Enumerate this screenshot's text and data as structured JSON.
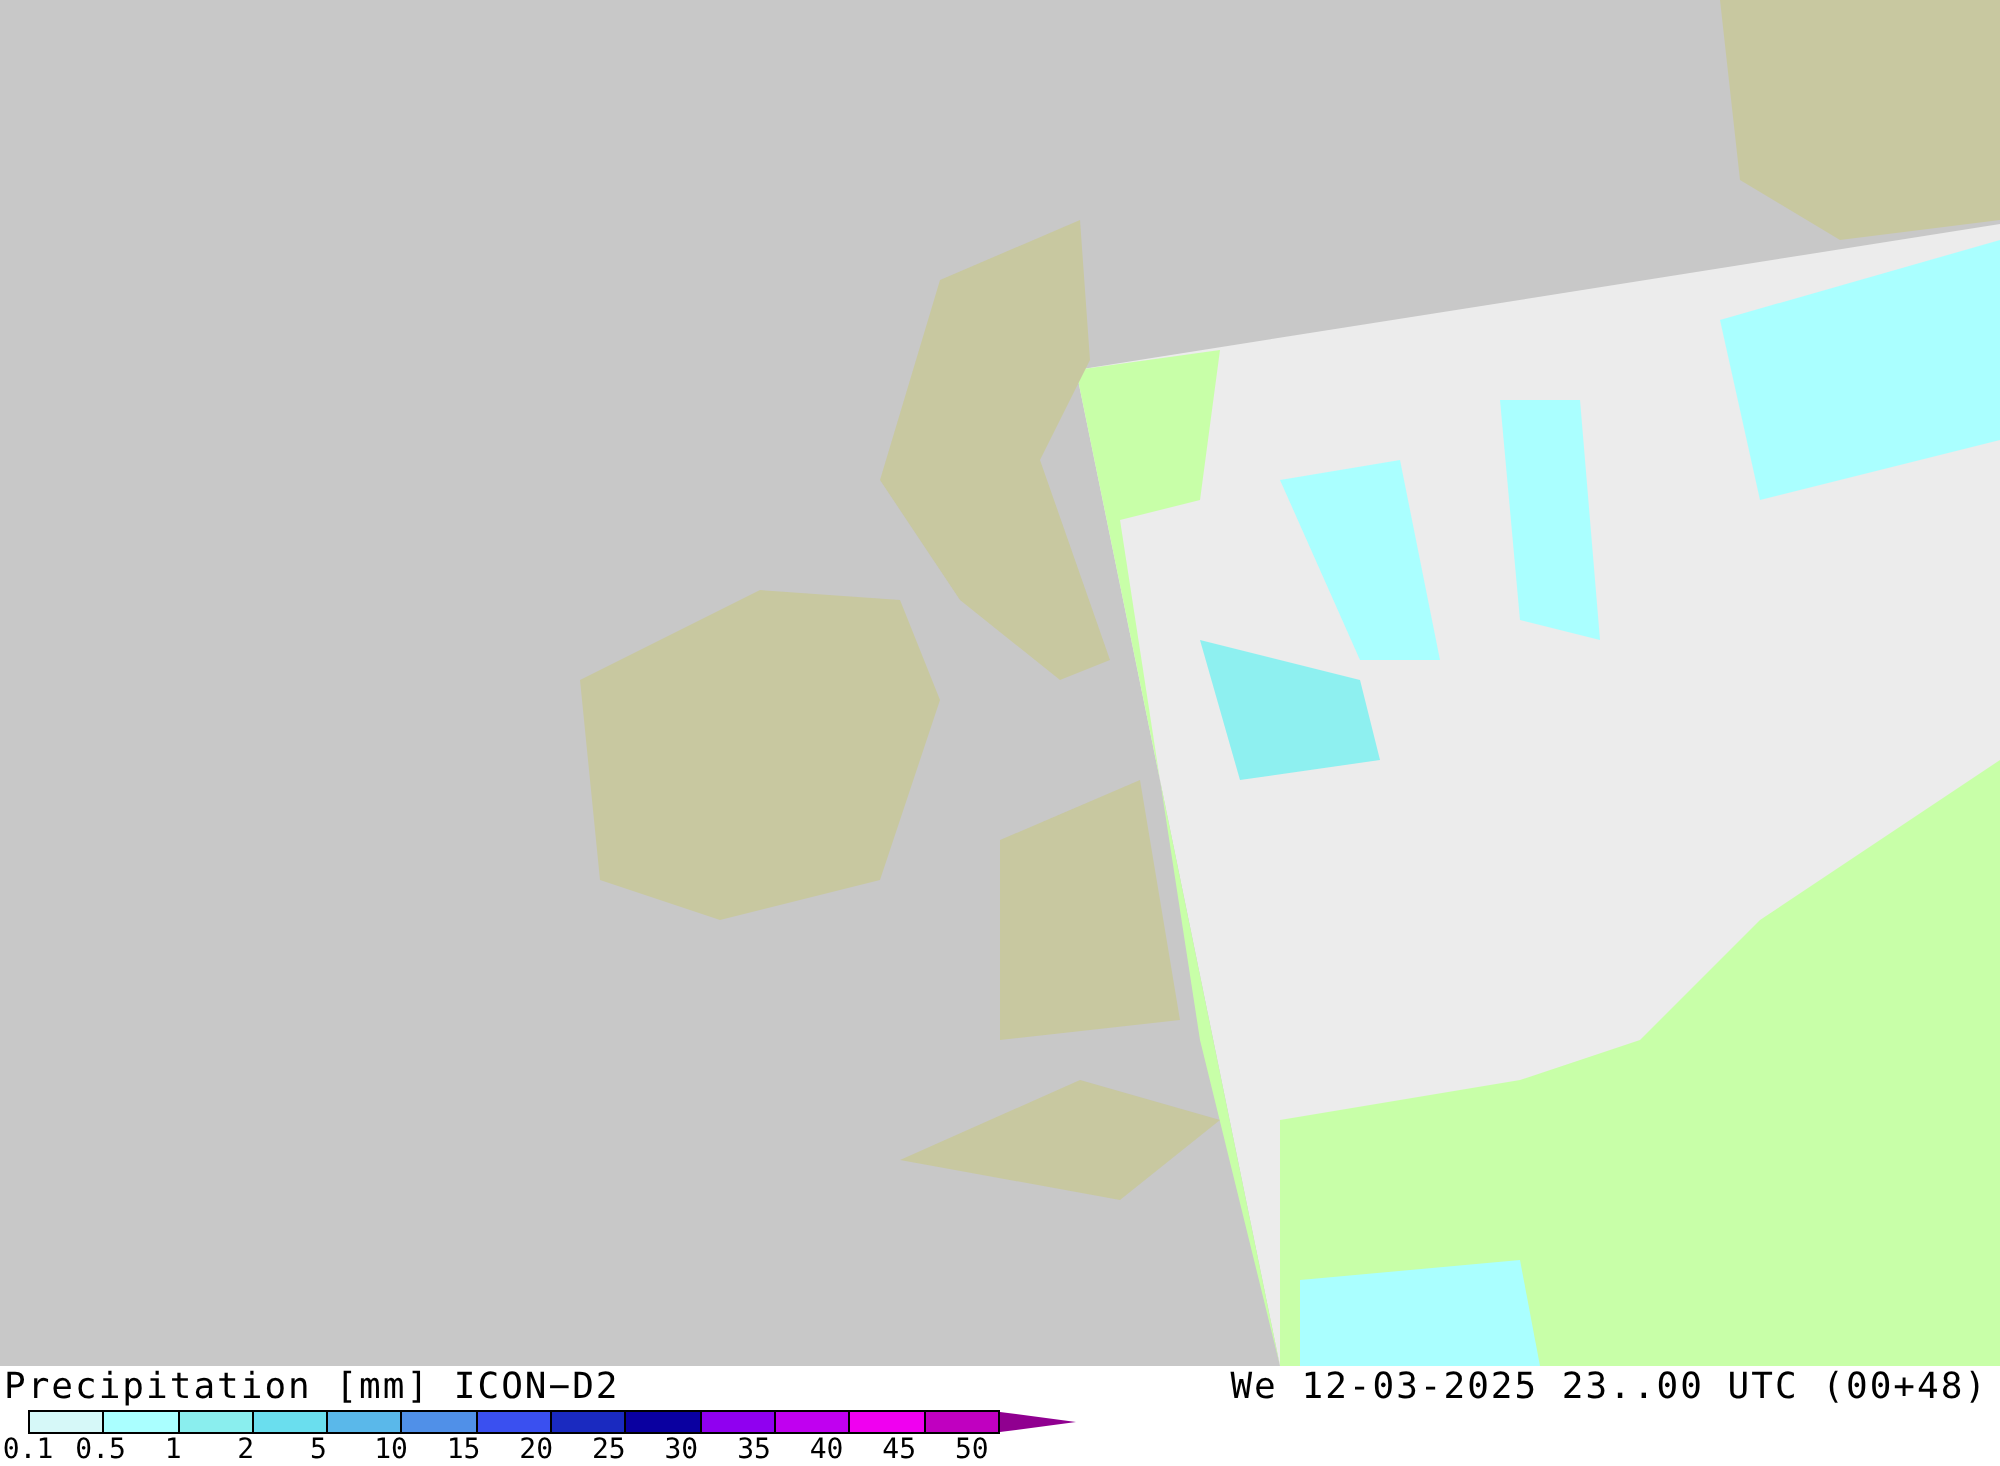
{
  "title": "Precipitation [mm] ICON−D2",
  "valid_time": "We 12-03-2025 23..00 UTC (00+48)",
  "scale": {
    "bins": [
      {
        "color": "#d6f8f8"
      },
      {
        "color": "#aaffff"
      },
      {
        "color": "#8aeeee"
      },
      {
        "color": "#6adeee"
      },
      {
        "color": "#5ab8ea"
      },
      {
        "color": "#5090e8"
      },
      {
        "color": "#3a50f0"
      },
      {
        "color": "#1a2ac0"
      },
      {
        "color": "#0a00a0"
      },
      {
        "color": "#9000f0"
      },
      {
        "color": "#c000f0"
      },
      {
        "color": "#f000f0"
      },
      {
        "color": "#c000c0"
      },
      {
        "kind": "arrow",
        "color": "#900090"
      }
    ],
    "labels": [
      "0.1",
      "0.5",
      "1",
      "2",
      "5",
      "10",
      "15",
      "20",
      "25",
      "30",
      "35",
      "40",
      "45",
      "50"
    ]
  }
}
